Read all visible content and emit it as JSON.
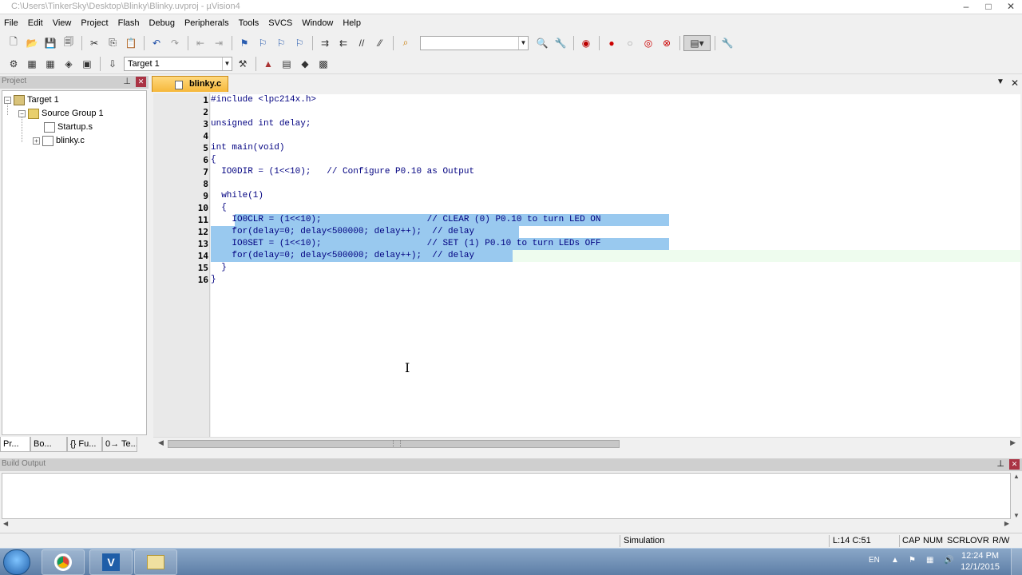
{
  "window": {
    "title": "C:\\Users\\TinkerSky\\Desktop\\Blinky\\Blinky.uvproj - µVision4",
    "controls": [
      "–",
      "□",
      "✕"
    ]
  },
  "menu": [
    "File",
    "Edit",
    "View",
    "Project",
    "Flash",
    "Debug",
    "Peripherals",
    "Tools",
    "SVCS",
    "Window",
    "Help"
  ],
  "toolbar": {
    "target_select": "Target 1",
    "find_combo": ""
  },
  "project_pane": {
    "title": "Project",
    "tree": [
      {
        "label": "Target 1",
        "level": 0
      },
      {
        "label": "Source Group 1",
        "level": 1
      },
      {
        "label": "Startup.s",
        "level": 2
      },
      {
        "label": "blinky.c",
        "level": 2
      }
    ],
    "tabs": [
      "Pr...",
      "Bo...",
      "{} Fu...",
      "0→ Te..."
    ]
  },
  "editor": {
    "active_tab": "blinky.c",
    "line_numbers": [
      "1",
      "2",
      "3",
      "4",
      "5",
      "6",
      "7",
      "8",
      "9",
      "10",
      "11",
      "12",
      "13",
      "14",
      "15",
      "16"
    ],
    "lines": [
      "#include <lpc214x.h>",
      "",
      "unsigned int delay;",
      "",
      "int main(void)",
      "{",
      "  IO0DIR = (1<<10);   // Configure P0.10 as Output",
      "",
      "  while(1)",
      "  {",
      "    IO0CLR = (1<<10);                    // CLEAR (0) P0.10 to turn LED ON",
      "    for(delay=0; delay<500000; delay++);  // delay",
      "    IO0SET = (1<<10);                    // SET (1) P0.10 to turn LEDs OFF",
      "    for(delay=0; delay<500000; delay++);  // delay",
      "  }",
      "}"
    ]
  },
  "build_output": {
    "title": "Build Output"
  },
  "statusbar": {
    "mode": "Simulation",
    "position": "L:14 C:51",
    "cap": "CAP",
    "num": "NUM",
    "scrl": "SCRL",
    "ovr": "OVR",
    "rw": "R/W"
  },
  "taskbar": {
    "lang": "EN",
    "time": "12:24 PM",
    "date": "12/1/2015"
  }
}
